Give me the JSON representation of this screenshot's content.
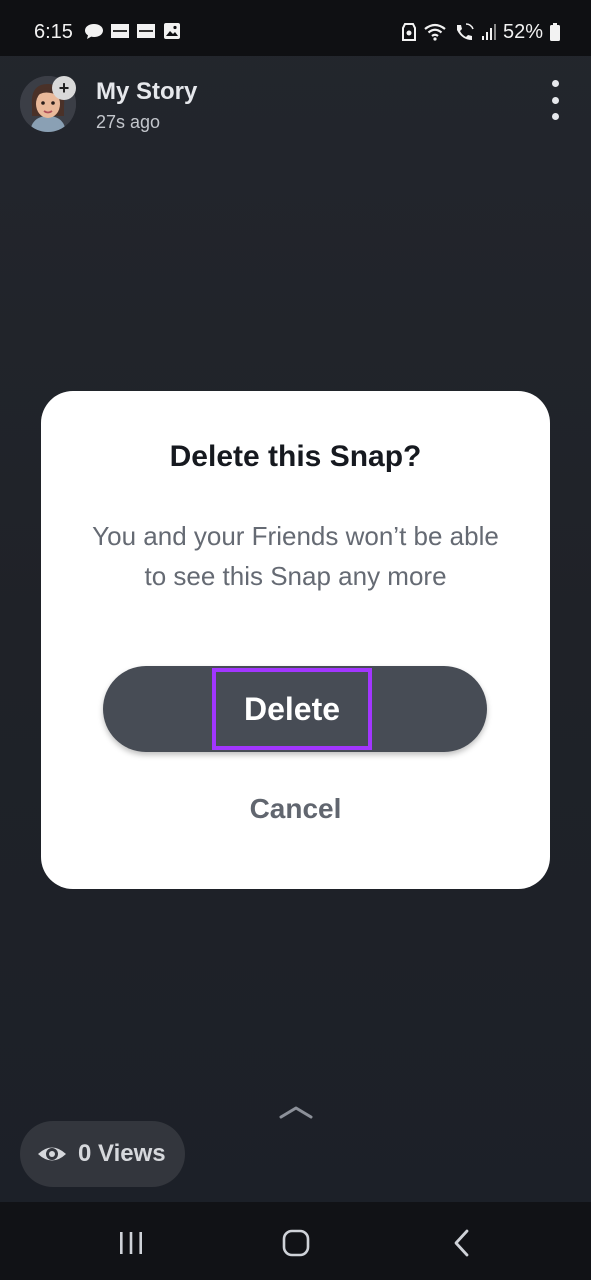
{
  "status_bar": {
    "time": "6:15",
    "battery": "52%"
  },
  "story": {
    "title": "My Story",
    "time_ago": "27s ago",
    "add_symbol": "+"
  },
  "dialog": {
    "title": "Delete this Snap?",
    "message": "You and your Friends won’t be able to see this Snap any more",
    "delete_label": "Delete",
    "cancel_label": "Cancel"
  },
  "footer": {
    "views_label": "0 Views"
  },
  "colors": {
    "highlight": "#a236ff",
    "delete_button": "#474c55",
    "dialog_bg": "#ffffff",
    "background": "#1f2228"
  },
  "icons": {
    "status": [
      "chat-bubble-icon",
      "news-app-icon",
      "news-app-icon",
      "gallery-icon",
      "data-saver-icon",
      "wifi-icon",
      "wifi-call-icon",
      "signal-icon",
      "battery-icon"
    ],
    "header": [
      "avatar",
      "more-vert-icon"
    ],
    "footer": [
      "chevron-up-icon",
      "eye-icon"
    ],
    "navigation": [
      "recent-apps-icon",
      "home-icon",
      "back-icon"
    ]
  }
}
